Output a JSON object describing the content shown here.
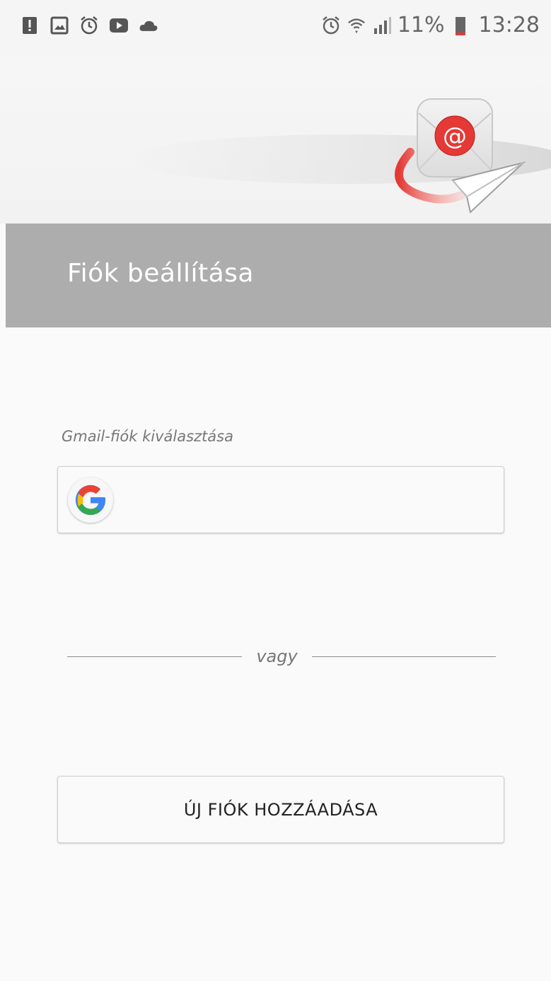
{
  "status_bar": {
    "left_icons": [
      "warning-icon",
      "image-icon",
      "alarm-icon",
      "youtube-icon",
      "cloud-icon"
    ],
    "right_icons": [
      "alarm-icon",
      "wifi-icon",
      "signal-icon",
      "battery-icon"
    ],
    "battery_percent": "11%",
    "time": "13:28"
  },
  "header": {
    "title": "Fiók beállítása"
  },
  "gmail": {
    "label": "Gmail-fiók kiválasztása",
    "icon": "google-icon"
  },
  "divider": {
    "text": "vagy"
  },
  "actions": {
    "add_account_label": "ÚJ FIÓK HOZZÁADÁSA"
  },
  "colors": {
    "title_band": "#adadad",
    "accent_red": "#e53935",
    "background": "#fafafa"
  }
}
